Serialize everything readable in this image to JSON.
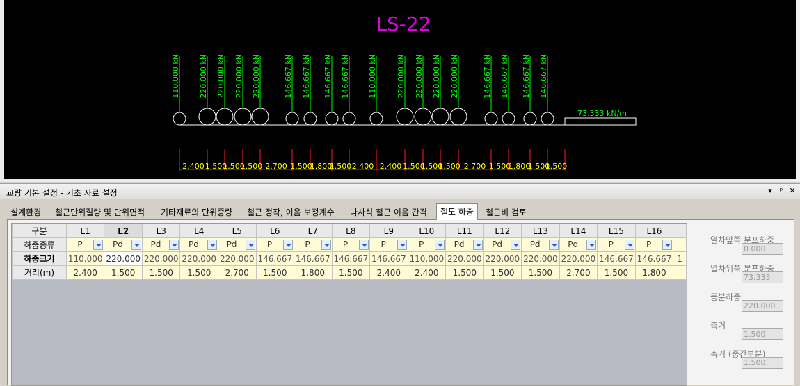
{
  "drawing": {
    "title": "LS-22",
    "axle_loads": [
      "110.000 kN",
      "220.000 kN",
      "220.000 kN",
      "220.000 kN",
      "220.000 kN",
      "146.667 kN",
      "146.667 kN",
      "146.667 kN",
      "146.667 kN",
      "110.000 kN",
      "220.000 kN",
      "220.000 kN",
      "220.000 kN",
      "220.000 kN",
      "146.667 kN",
      "146.667 kN",
      "146.667 kN",
      "146.667 kN"
    ],
    "distributed_load": "73.333 kN/m",
    "spacings": [
      "2.400",
      "1.500",
      "1.500",
      "1.500",
      "2.700",
      "1.500",
      "1.800",
      "1.500",
      "2.400",
      "2.400",
      "1.500",
      "1.500",
      "1.500",
      "2.700",
      "1.500",
      "1.800",
      "1.500",
      "1.500"
    ],
    "colors": {
      "title": "#e000e0",
      "loads": "#00ff00",
      "geometry": "#ffffff",
      "dims": "#ff2020",
      "dim_text": "#ffff00",
      "background": "#000000"
    }
  },
  "panel": {
    "title": "교량 기본 설정 - 기초 자료 설정",
    "controls": [
      "▾",
      "ᵖ",
      "✕"
    ],
    "tabs": [
      "설계환경",
      "철근단위질량 및 단위면적",
      "기타재료의 단위중량",
      "철근 정착, 이음 보정계수",
      "나사식 철근 이음 간격",
      "철도 하중",
      "철근비 검토"
    ],
    "active_tab": 5
  },
  "grid": {
    "corner": "구분",
    "columns": [
      "L1",
      "L2",
      "L3",
      "L4",
      "L5",
      "L6",
      "L7",
      "L8",
      "L9",
      "L10",
      "L11",
      "L12",
      "L13",
      "L14",
      "L15",
      "L16"
    ],
    "selected_column": 1,
    "row_labels": [
      "하중종류",
      "하중크기",
      "거리(m)"
    ],
    "load_types": [
      "P",
      "Pd",
      "Pd",
      "Pd",
      "Pd",
      "P",
      "P",
      "P",
      "P",
      "P",
      "Pd",
      "Pd",
      "Pd",
      "Pd",
      "P",
      "P"
    ],
    "load_sizes": [
      "110.000",
      "220.000",
      "220.000",
      "220.000",
      "220.000",
      "146.667",
      "146.667",
      "146.667",
      "146.667",
      "110.000",
      "220.000",
      "220.000",
      "220.000",
      "220.000",
      "146.667",
      "146.667"
    ],
    "distances": [
      "2.400",
      "1.500",
      "1.500",
      "1.500",
      "2.700",
      "1.500",
      "1.800",
      "1.500",
      "2.400",
      "2.400",
      "1.500",
      "1.500",
      "1.500",
      "2.700",
      "1.500",
      "1.800"
    ]
  },
  "side": {
    "fields": [
      {
        "label": "열차앞쪽 분포하중",
        "value": "0.000"
      },
      {
        "label": "열차뒤쪽 분포하중",
        "value": "73.333"
      },
      {
        "label": "등분하중",
        "value": "220.000"
      },
      {
        "label": "축거",
        "value": "1.500"
      },
      {
        "label": "축거 (중간부분)",
        "value": "1.500"
      }
    ]
  }
}
